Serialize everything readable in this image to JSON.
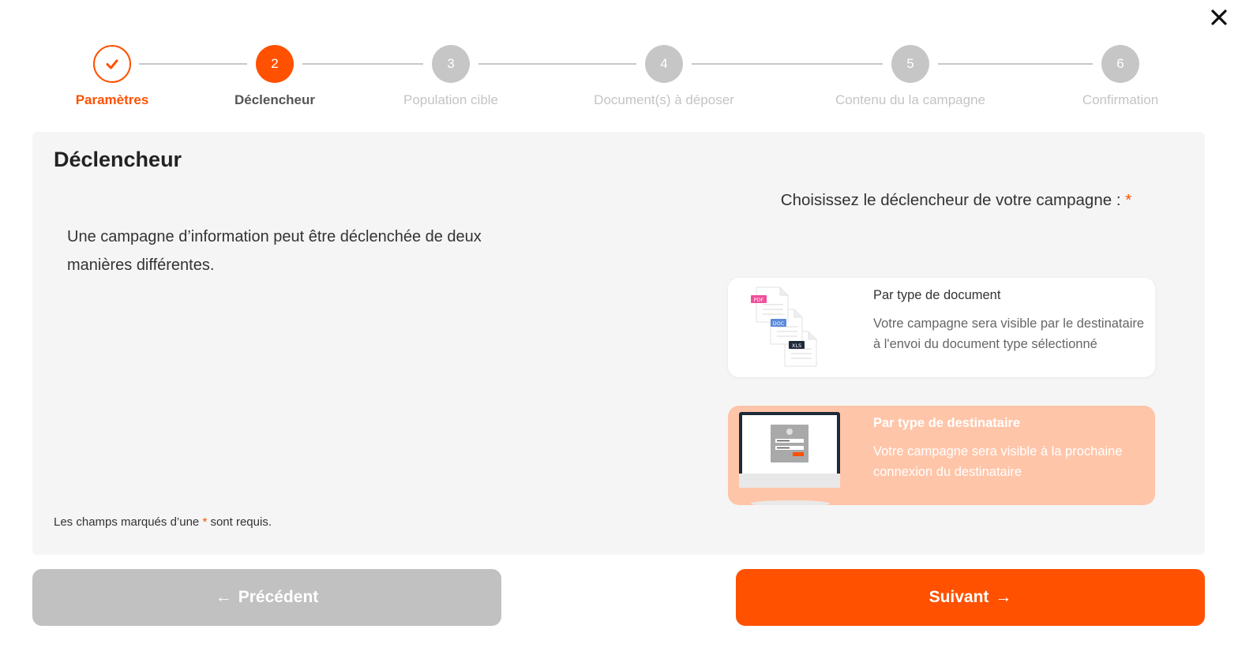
{
  "header": {
    "close_icon": "close-icon"
  },
  "steps": [
    {
      "number": "1",
      "label": "Paramètres",
      "state": "done"
    },
    {
      "number": "2",
      "label": "Déclencheur",
      "state": "active"
    },
    {
      "number": "3",
      "label": "Population cible",
      "state": "todo"
    },
    {
      "number": "4",
      "label": "Document(s) à déposer",
      "state": "todo"
    },
    {
      "number": "5",
      "label": "Contenu du la campagne",
      "state": "todo"
    },
    {
      "number": "6",
      "label": "Confirmation",
      "state": "todo"
    }
  ],
  "panel": {
    "title": "Déclencheur",
    "intro": "Une campagne d’information peut être déclenchée de deux manières différentes.",
    "choose_label": "Choisissez le déclencheur de votre campagne :",
    "required_star": "*",
    "required_note_before": "Les champs marqués d’une ",
    "required_note_after": " sont requis.",
    "options": [
      {
        "title": "Par type de document",
        "description": "Votre campagne sera visible par le destinataire à l'envoi du document type sélectionné",
        "selected": false,
        "badges": [
          "PDF",
          "DOC",
          "XLS"
        ]
      },
      {
        "title": "Par type de destinataire",
        "description": "Votre campagne sera visible à la prochaine connexion du destinataire",
        "selected": true
      }
    ]
  },
  "footer": {
    "prev_label": "Précédent",
    "next_label": "Suivant",
    "prev_arrow": "←",
    "next_arrow": "→"
  },
  "colors": {
    "accent": "#ff5100",
    "selected_bg": "#ffc5a9",
    "inactive": "#c1c1c1"
  }
}
